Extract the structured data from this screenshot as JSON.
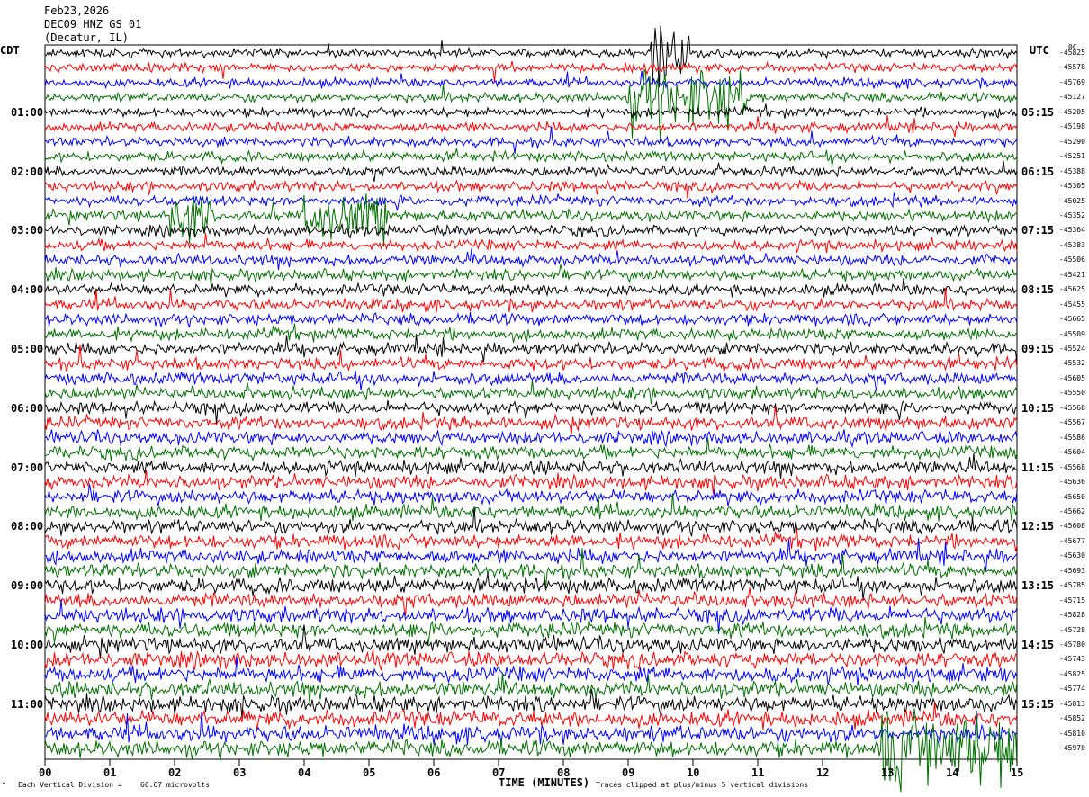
{
  "header": {
    "date": "Feb23,2026",
    "station": "DEC09 HNZ GS 01",
    "location": "(Decatur, IL)"
  },
  "axes": {
    "left_tz": "CDT",
    "right_tz": "UTC",
    "corner_label": "0C",
    "xlabel": "TIME (MINUTES)"
  },
  "footer": {
    "scale_left": "Each Vertical Division =",
    "scale_value": "66.67 microvolts",
    "clip_note": "Traces clipped at plus/minus 5 vertical divisions",
    "mark": "^"
  },
  "colors": {
    "trace_cycle": [
      "#000000",
      "#ff0000",
      "#0000ff",
      "#007000"
    ],
    "background": "#ffffff"
  },
  "chart_data": {
    "type": "line",
    "description_kind": "helicorder",
    "x_ticks": [
      "00",
      "01",
      "02",
      "03",
      "04",
      "05",
      "06",
      "07",
      "08",
      "09",
      "10",
      "11",
      "12",
      "13",
      "14",
      "15"
    ],
    "xlim": [
      0,
      15
    ],
    "rows_per_hour": 4,
    "left_hour_labels": [
      "01:00",
      "02:00",
      "03:00",
      "04:00",
      "05:00",
      "06:00",
      "07:00",
      "08:00",
      "09:00",
      "10:00",
      "11:00"
    ],
    "right_hour_labels": [
      "05:15",
      "06:15",
      "07:15",
      "08:15",
      "09:15",
      "10:15",
      "11:15",
      "12:15",
      "13:15",
      "14:15",
      "15:15"
    ],
    "row_values": [
      "-45825",
      "-45578",
      "-45769",
      "-45127",
      "-45205",
      "-45198",
      "-45290",
      "-45251",
      "-45388",
      "-45305",
      "-45025",
      "-45352",
      "-45364",
      "-45383",
      "-45506",
      "-45421",
      "-45625",
      "-45455",
      "-45665",
      "-45509",
      "-45524",
      "-45532",
      "-45605",
      "-45550",
      "-45568",
      "-45567",
      "-45586",
      "-45604",
      "-45568",
      "-45636",
      "-45650",
      "-45662",
      "-45608",
      "-45677",
      "-45630",
      "-45693",
      "-45785",
      "-45715",
      "-45828",
      "-45728",
      "-45780",
      "-45743",
      "-45825",
      "-45774",
      "-45813",
      "-45852",
      "-45810",
      "-45970"
    ],
    "events": [
      {
        "row": 0,
        "start_min": 9.35,
        "end_min": 9.95,
        "color_index": 0,
        "amp": 26
      },
      {
        "row": 3,
        "start_min": 9.0,
        "end_min": 10.85,
        "color_index": 3,
        "amp": 24
      },
      {
        "row": 11,
        "start_min": 1.9,
        "end_min": 2.6,
        "color_index": 3,
        "amp": 18
      },
      {
        "row": 11,
        "start_min": 4.0,
        "end_min": 5.3,
        "color_index": 3,
        "amp": 18
      },
      {
        "row": 47,
        "start_min": 12.9,
        "end_min": 15.0,
        "color_index": 3,
        "amp": 30
      }
    ]
  }
}
